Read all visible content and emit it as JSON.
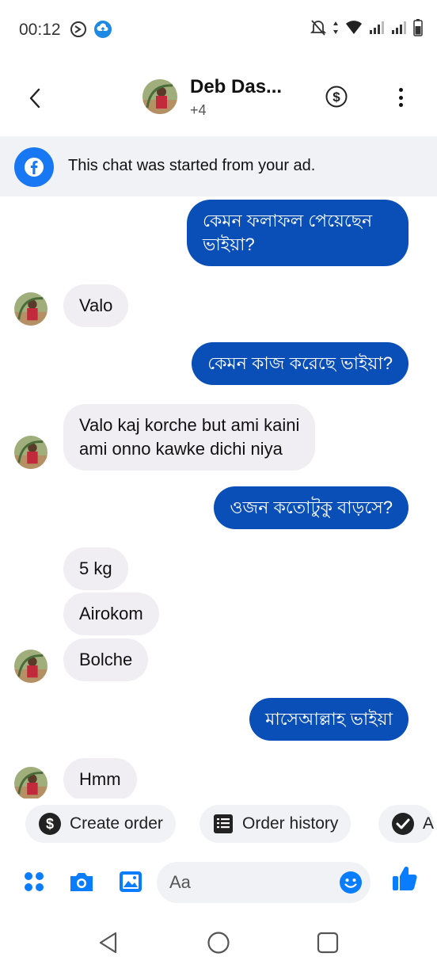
{
  "status": {
    "time": "00:12"
  },
  "header": {
    "contact_name": "Deb Das...",
    "participants_extra": "+4"
  },
  "ad_banner": {
    "text": "This chat was started from your ad."
  },
  "messages": [
    {
      "direction": "outgoing",
      "text_line1": "কেমন ফলাফল পেয়েছেন",
      "text_line2": "ভাইয়া?"
    },
    {
      "direction": "incoming",
      "text": "Valo"
    },
    {
      "direction": "outgoing",
      "text": "কেমন কাজ করেছে ভাইয়া?"
    },
    {
      "direction": "incoming",
      "text_line1": "Valo kaj korche but ami kaini",
      "text_line2": "ami onno kawke dichi niya"
    },
    {
      "direction": "outgoing",
      "text": "ওজন কতোটুকু বাড়সে?"
    },
    {
      "direction": "incoming",
      "text": "5 kg"
    },
    {
      "direction": "incoming",
      "text": "Airokom"
    },
    {
      "direction": "incoming",
      "text": "Bolche"
    },
    {
      "direction": "outgoing",
      "text": "মাসেআল্লাহ ভাইয়া"
    },
    {
      "direction": "incoming",
      "text": "Hmm"
    }
  ],
  "quick_actions": {
    "create_order": "Create order",
    "order_history": "Order history",
    "third_partial": "A"
  },
  "composer": {
    "placeholder": "Aa"
  },
  "colors": {
    "outgoing_bubble": "#0a4fb7",
    "incoming_bubble": "#f0eef2",
    "accent_blue": "#1877f2",
    "banner_bg": "#f0f2f5"
  },
  "icons": {
    "status_left": [
      "dnd-icon",
      "cloud-upload-icon"
    ],
    "status_right": [
      "muted-bell-icon",
      "data-arrows-icon",
      "wifi-icon",
      "signal-icon",
      "signal-icon",
      "battery-icon"
    ],
    "header": [
      "back-arrow-icon",
      "dollar-circle-icon",
      "more-vertical-icon"
    ],
    "composer": [
      "apps-grid-icon",
      "camera-icon",
      "gallery-icon",
      "emoji-icon",
      "thumbs-up-icon"
    ],
    "nav": [
      "nav-back-icon",
      "nav-home-icon",
      "nav-recents-icon"
    ]
  }
}
